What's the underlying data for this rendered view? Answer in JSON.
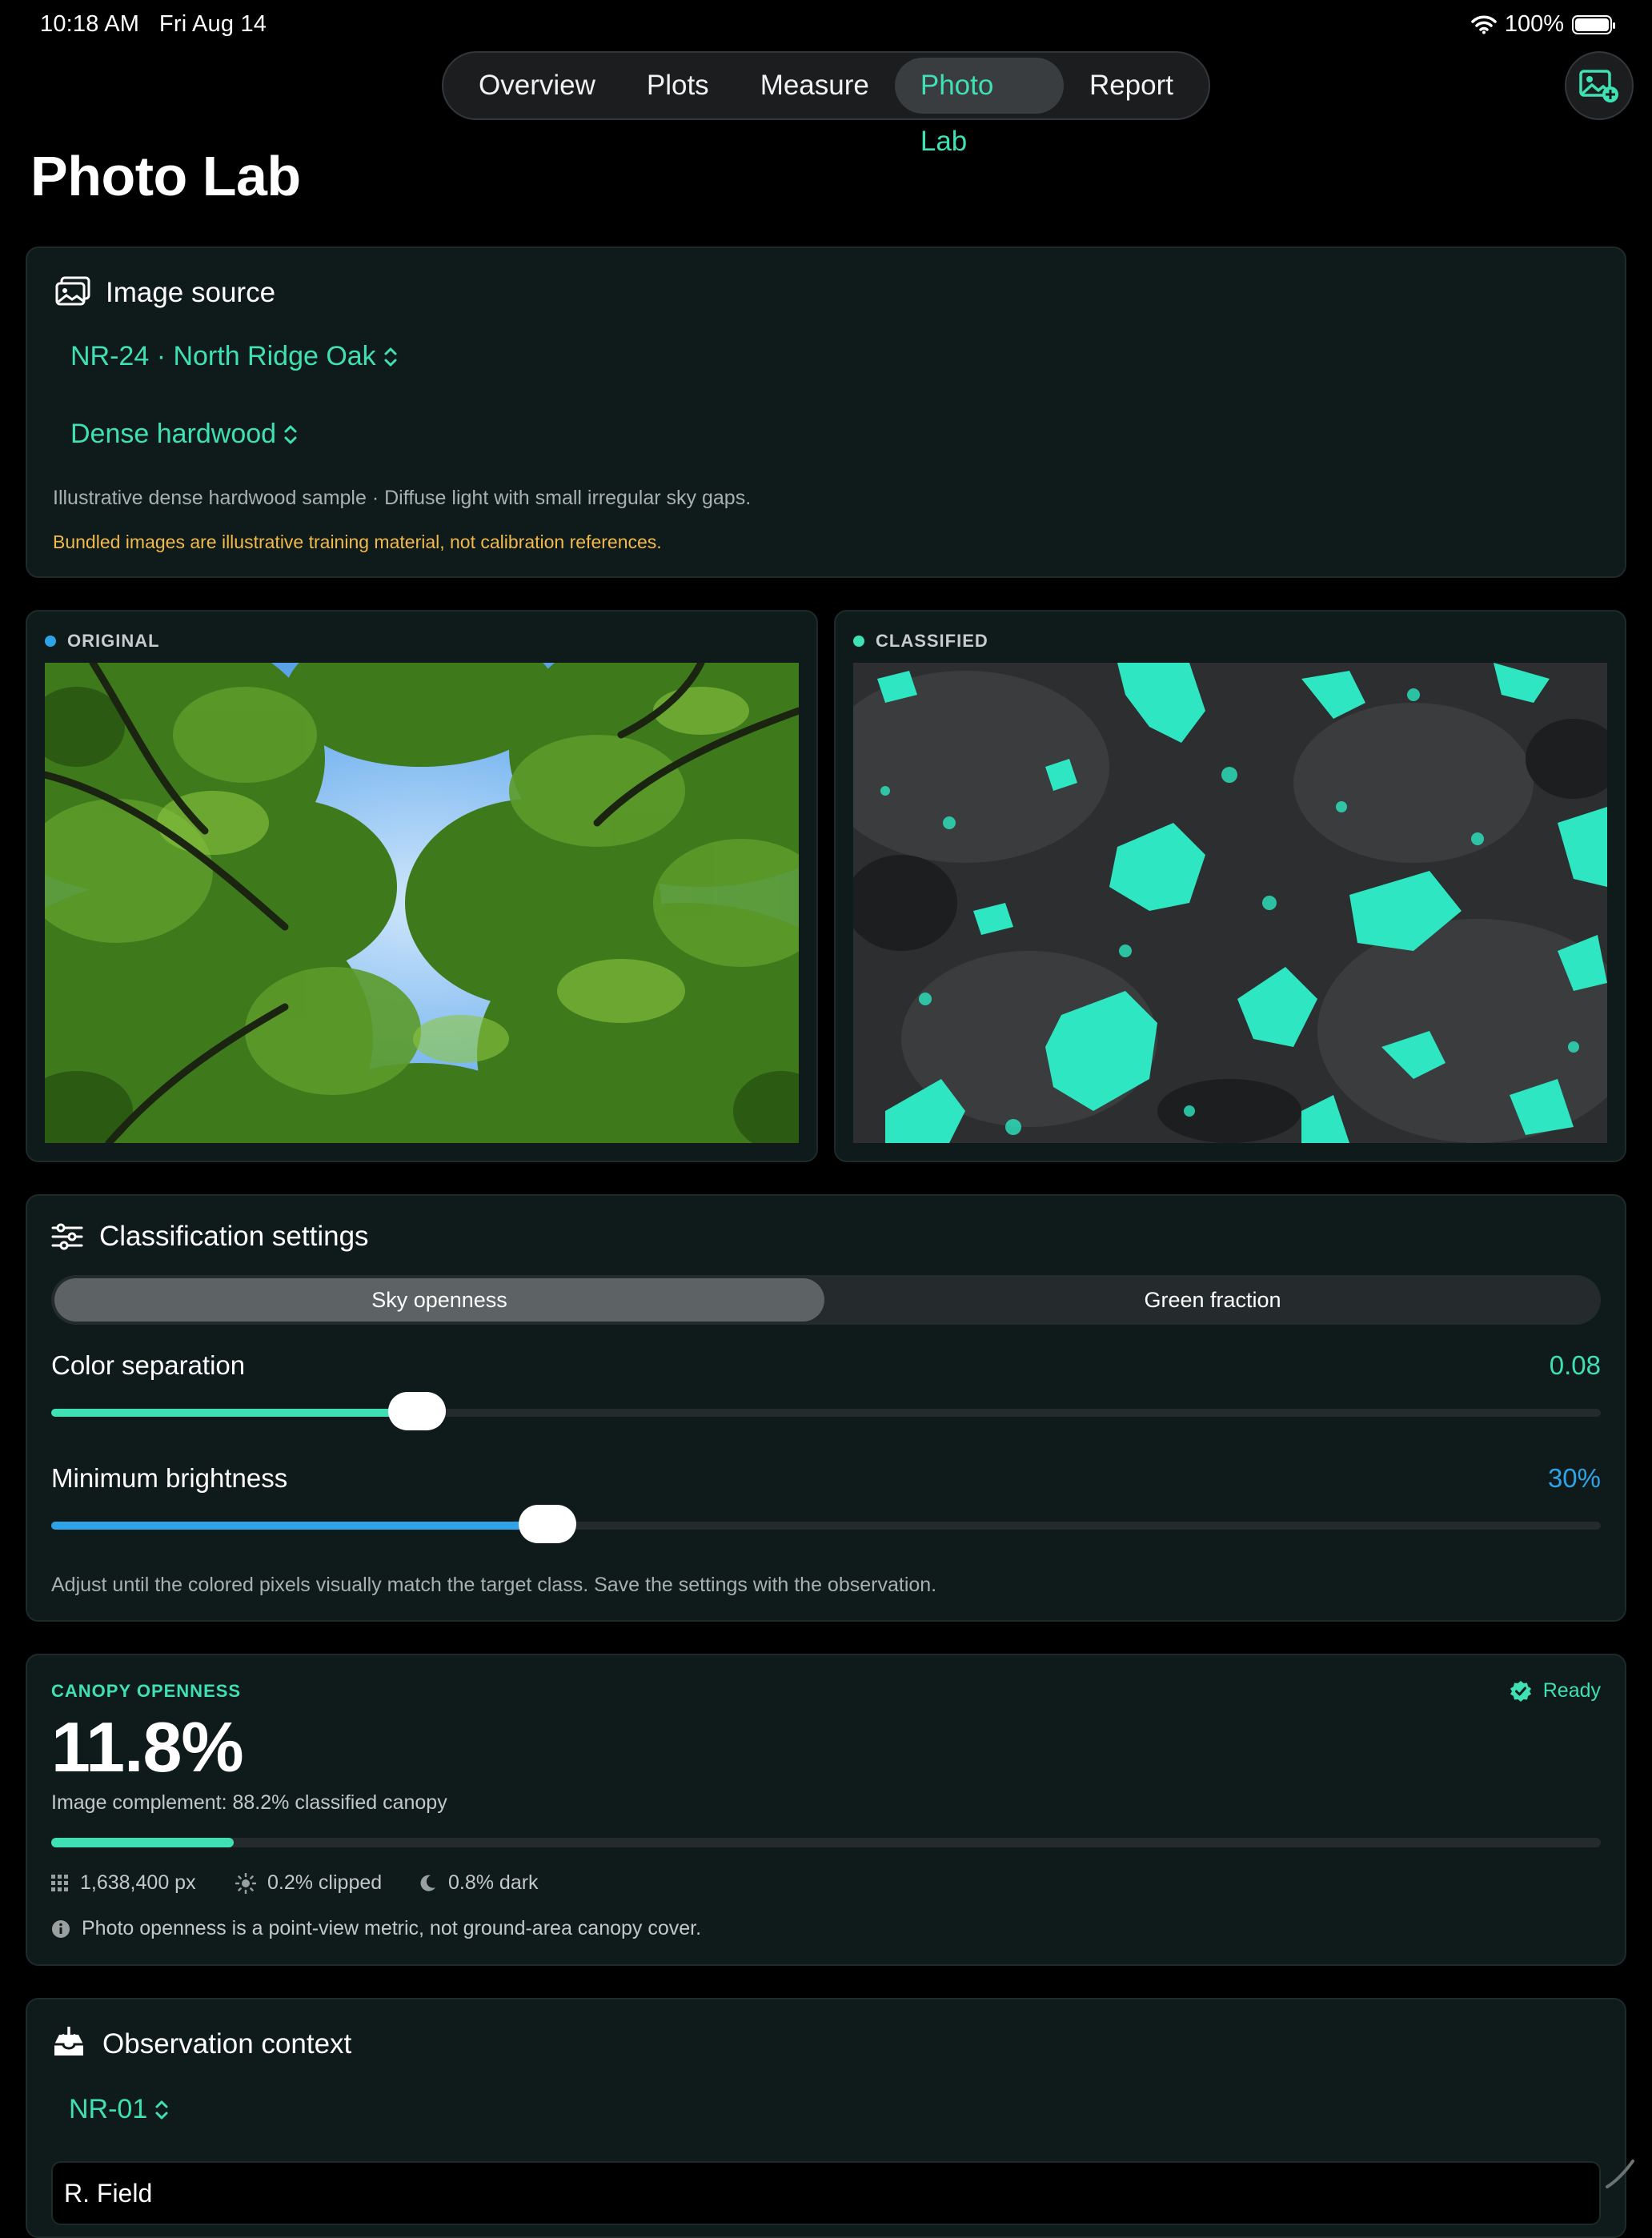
{
  "status": {
    "time": "10:18 AM",
    "date": "Fri Aug 14",
    "battery": "100%"
  },
  "tabs": [
    {
      "label": "Overview",
      "active": false
    },
    {
      "label": "Plots",
      "active": false
    },
    {
      "label": "Measure",
      "active": false
    },
    {
      "label": "Photo Lab",
      "active": true
    },
    {
      "label": "Report",
      "active": false
    }
  ],
  "page": {
    "title": "Photo Lab"
  },
  "colors": {
    "accent": "#3fe0b4",
    "blue": "#2fa3e8",
    "warning": "#f2b94b",
    "card": "#0f1a1a"
  },
  "image_source": {
    "title": "Image source",
    "site": "NR-24 · North Ridge Oak",
    "sample": "Dense hardwood",
    "description": "Illustrative dense hardwood sample · Diffuse light with small irregular sky gaps.",
    "warning": "Bundled images are illustrative training material, not calibration references."
  },
  "panels": {
    "original_label": "ORIGINAL",
    "classified_label": "CLASSIFIED"
  },
  "classification": {
    "title": "Classification settings",
    "modes": [
      {
        "label": "Sky openness",
        "active": true
      },
      {
        "label": "Green fraction",
        "active": false
      }
    ],
    "color_separation": {
      "label": "Color separation",
      "value": "0.08",
      "fraction": 0.236
    },
    "min_brightness": {
      "label": "Minimum brightness",
      "value": "30%",
      "fraction": 0.32
    },
    "hint": "Adjust until the colored pixels visually match the target class. Save the settings with the observation."
  },
  "canopy": {
    "label": "CANOPY OPENNESS",
    "status": "Ready",
    "value": "11.8%",
    "fraction": 0.118,
    "complement": "Image complement: 88.2% classified canopy",
    "pixels": "1,638,400 px",
    "clipped": "0.2% clipped",
    "dark": "0.8% dark",
    "note": "Photo openness is a point-view metric, not ground-area canopy cover."
  },
  "observation": {
    "title": "Observation context",
    "plot": "NR-01",
    "observer": "R. Field"
  }
}
